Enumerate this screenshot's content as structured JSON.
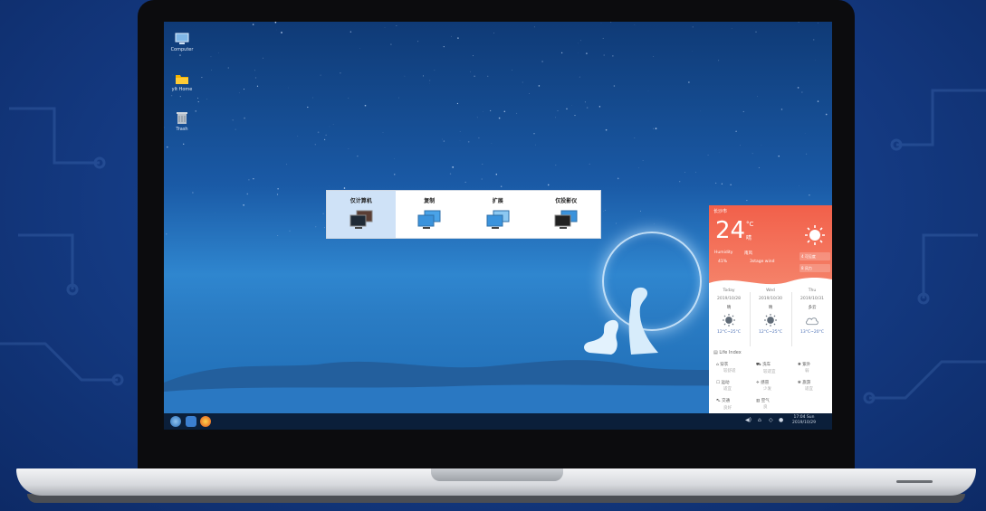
{
  "desktop": {
    "icons": [
      {
        "label": "Computer",
        "icon": "computer-icon"
      },
      {
        "label": "ylt Home",
        "icon": "folder-icon"
      },
      {
        "label": "Trash",
        "icon": "trash-icon"
      }
    ]
  },
  "display_switch": {
    "options": [
      {
        "label": "仅计算机",
        "icon": "computer-only-icon",
        "selected": true
      },
      {
        "label": "复制",
        "icon": "mirror-display-icon",
        "selected": false
      },
      {
        "label": "扩展",
        "icon": "extend-display-icon",
        "selected": false
      },
      {
        "label": "仅投影仪",
        "icon": "projector-only-icon",
        "selected": false
      }
    ]
  },
  "weather": {
    "location": "长沙市",
    "temperature": "24",
    "unit": "°C",
    "condition": "晴",
    "humidity_label": "Humidity",
    "humidity_value": "41%",
    "wind_label": "南风",
    "wind_value": "3stage wind",
    "button_1": "4 可见度",
    "button_2": "8 风力",
    "days": [
      {
        "name": "Today",
        "date": "2019/10/28",
        "condition": "晴",
        "icon": "sun-icon",
        "range": "12°C~25°C"
      },
      {
        "name": "Wed",
        "date": "2019/10/30",
        "condition": "晴",
        "icon": "sun-icon",
        "range": "12°C~25°C"
      },
      {
        "name": "Thu",
        "date": "2019/10/31",
        "condition": "多云",
        "icon": "cloud-icon",
        "range": "13°C~20°C"
      }
    ],
    "life_title": "Life Index",
    "indexes": [
      {
        "label": "穿衣",
        "sub": "较舒适",
        "icon": "shirt-icon"
      },
      {
        "label": "洗车",
        "sub": "较适宜",
        "icon": "car-wash-icon"
      },
      {
        "label": "紫外",
        "sub": "弱",
        "icon": "uv-icon"
      },
      {
        "label": "运动",
        "sub": "适宜",
        "icon": "sport-icon"
      },
      {
        "label": "感冒",
        "sub": "少发",
        "icon": "cold-icon"
      },
      {
        "label": "旅游",
        "sub": "适宜",
        "icon": "travel-icon"
      },
      {
        "label": "交通",
        "sub": "良好",
        "icon": "traffic-icon"
      },
      {
        "label": "空气",
        "sub": "良",
        "icon": "air-icon"
      }
    ]
  },
  "taskbar": {
    "clock_time": "17:04 Sun",
    "clock_date": "2019/10/29"
  },
  "colors": {
    "weather_accent": "#f2604a",
    "selected_option": "#cfe2f7",
    "taskbar": "#0b1f3a"
  }
}
